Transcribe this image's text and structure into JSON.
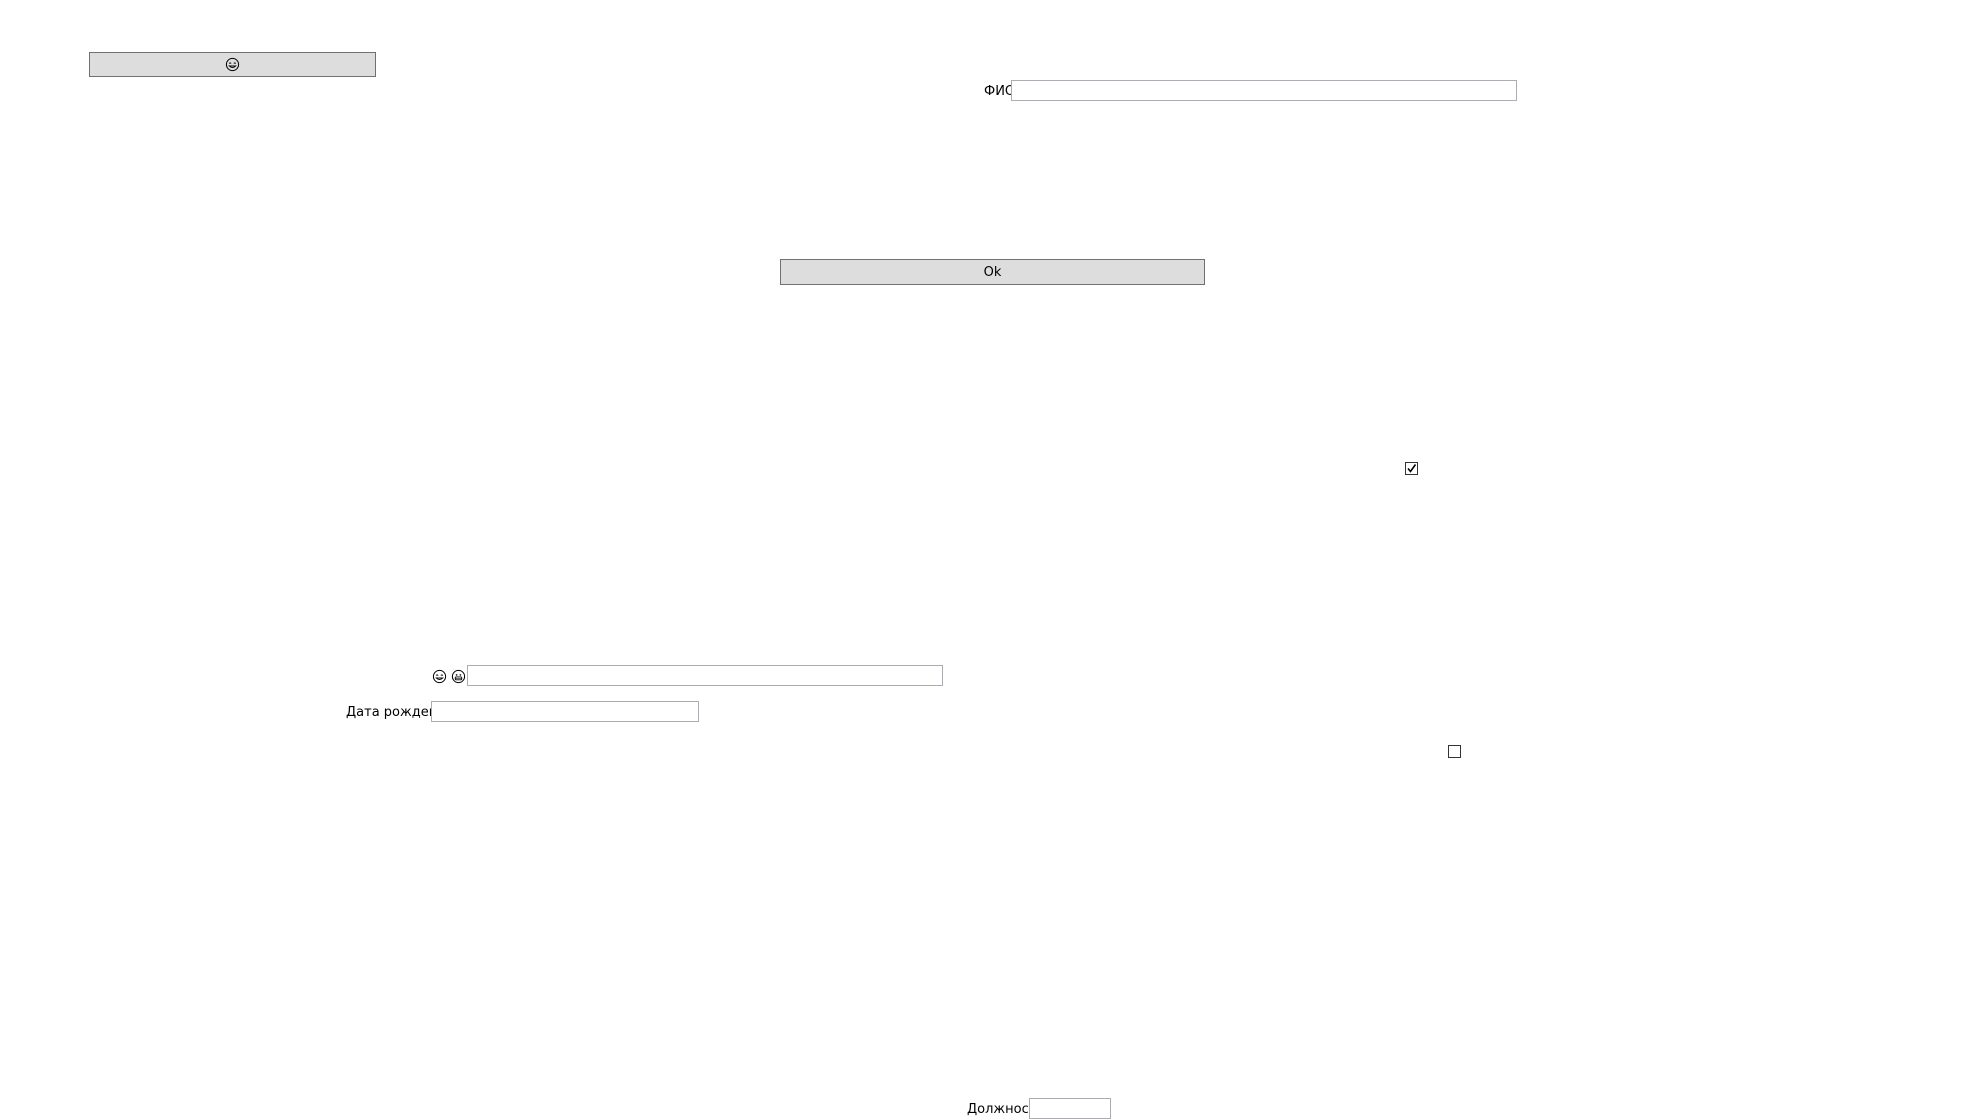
{
  "top_button": {
    "icon": "smiley-face-icon"
  },
  "fio": {
    "label": "ФИО",
    "value": "",
    "placeholder": ""
  },
  "ok_button": {
    "label": "Ok"
  },
  "checkbox_1": {
    "checked": true
  },
  "emoji_row": {
    "icons": [
      "smiley-face-icon",
      "grin-face-icon"
    ],
    "value": ""
  },
  "birth_date": {
    "label": "Дата рождения",
    "value": ""
  },
  "checkbox_2": {
    "checked": false
  },
  "position": {
    "label": "Должность",
    "value": ""
  },
  "colors": {
    "button_bg": "#dddddd",
    "button_border": "#707070",
    "input_border": "#abadb3"
  }
}
